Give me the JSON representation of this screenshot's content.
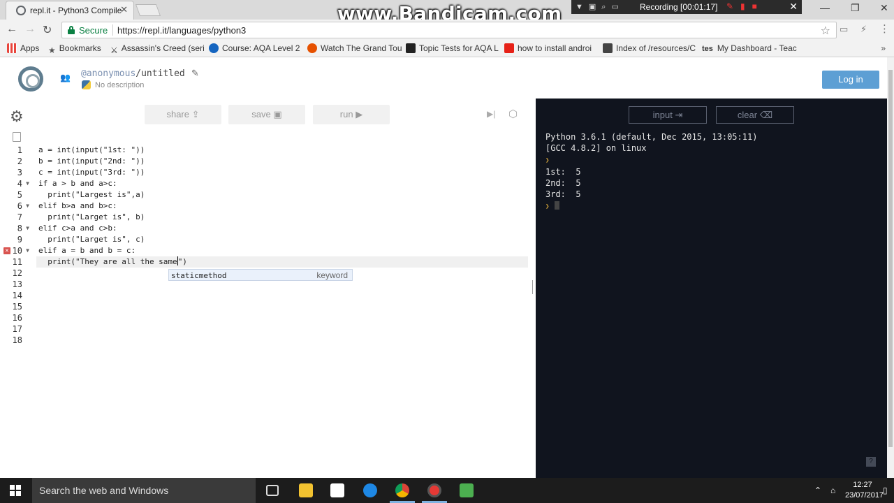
{
  "browser": {
    "tab_title": "repl.it - Python3 Compile",
    "secure_label": "Secure",
    "url": "https://repl.it/languages/python3"
  },
  "overlay": {
    "watermark": "www.Bandicam.com",
    "recording": "Recording [00:01:17]"
  },
  "bookmarks": [
    {
      "label": "Apps",
      "color": "#e8453c"
    },
    {
      "label": "Bookmarks",
      "color": "#555555"
    },
    {
      "label": "Assassin's Creed (seri",
      "color": "#333333"
    },
    {
      "label": "Course: AQA Level 2",
      "color": "#1565c0"
    },
    {
      "label": "Watch The Grand Tou",
      "color": "#e65100"
    },
    {
      "label": "Topic Tests for AQA L",
      "color": "#222222"
    },
    {
      "label": "how to install androi",
      "color": "#e62117"
    },
    {
      "label": "Index of /resources/C",
      "color": "#444444"
    },
    {
      "label": "My Dashboard - Teac",
      "color": "#222222",
      "prefix": "tes"
    }
  ],
  "repl": {
    "username": "@anonymous",
    "project_name": "/untitled",
    "description": "No description",
    "login_label": "Log in"
  },
  "editor": {
    "share_label": "share",
    "save_label": "save",
    "run_label": "run",
    "lines": [
      "a = int(input(\"1st: \"))",
      "b = int(input(\"2nd: \"))",
      "c = int(input(\"3rd: \"))",
      "if a > b and a>c:",
      "  print(\"Largest is\",a)",
      "elif b>a and b>c:",
      "  print(\"Larget is\", b)",
      "elif c>a and c>b:",
      "  print(\"Larget is\", c)",
      "elif a = b and b = c:",
      "  print(\"They are all the same\")",
      "",
      "",
      "",
      "",
      "",
      "",
      ""
    ],
    "line_numbers": [
      "1",
      "2",
      "3",
      "4",
      "5",
      "6",
      "7",
      "8",
      "9",
      "10",
      "11",
      "12",
      "13",
      "14",
      "15",
      "16",
      "17",
      "18"
    ],
    "autocomplete": {
      "word": "staticmethod",
      "kind": "keyword"
    }
  },
  "console": {
    "input_label": "input",
    "clear_label": "clear",
    "output": [
      "Python 3.6.1 (default, Dec 2015, 13:05:11)",
      "[GCC 4.8.2] on linux"
    ],
    "responses": [
      "1st:  5",
      "2nd:  5",
      "3rd:  5"
    ]
  },
  "taskbar": {
    "search_placeholder": "Search the web and Windows",
    "time": "12:27",
    "date": "23/07/2017"
  }
}
